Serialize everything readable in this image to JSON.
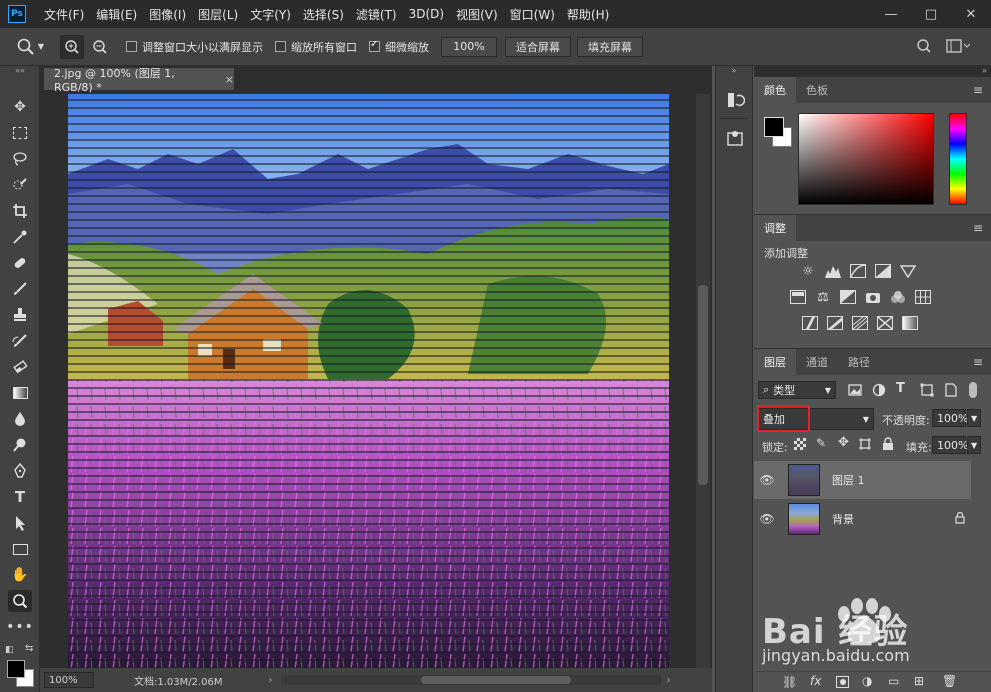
{
  "app": {
    "logo": "Ps",
    "menu": [
      "文件(F)",
      "编辑(E)",
      "图像(I)",
      "图层(L)",
      "文字(Y)",
      "选择(S)",
      "滤镜(T)",
      "3D(D)",
      "视图(V)",
      "窗口(W)",
      "帮助(H)"
    ],
    "window_controls": [
      "—",
      "□",
      "✕"
    ]
  },
  "options": {
    "resize_windows": "调整窗口大小以满屏显示",
    "zoom_all": "缩放所有窗口",
    "scrubby_zoom": "细微缩放",
    "zoom_value": "100%",
    "fit_screen": "适合屏幕",
    "fill_screen": "填充屏幕",
    "resize_checked": false,
    "zoom_all_checked": false,
    "scrubby_checked": true
  },
  "document": {
    "tab_title": "2.jpg @ 100% (图层 1, RGB/8) *",
    "tab_close": "×",
    "zoom": "100%",
    "doc_info": "文档:1.03M/2.06M"
  },
  "panels": {
    "color": {
      "tabs": [
        "颜色",
        "色板"
      ],
      "fg": "#000000",
      "bg": "#ffffff",
      "hue": "#ff0000"
    },
    "adjustments": {
      "tabs": [
        "调整"
      ],
      "add_label": "添加调整"
    },
    "layers": {
      "tabs": [
        "图层",
        "通道",
        "路径"
      ],
      "filter_kind": "类型",
      "blend_mode": "叠加",
      "opacity_label": "不透明度:",
      "opacity": "100%",
      "lock_label": "锁定:",
      "fill_label": "填充:",
      "fill": "100%",
      "items": [
        {
          "name": "图层 1",
          "selected": true
        },
        {
          "name": "背景",
          "locked": true
        }
      ]
    }
  },
  "watermark": {
    "brand": "Bai 经验",
    "url": "jingyan.baidu.com"
  }
}
